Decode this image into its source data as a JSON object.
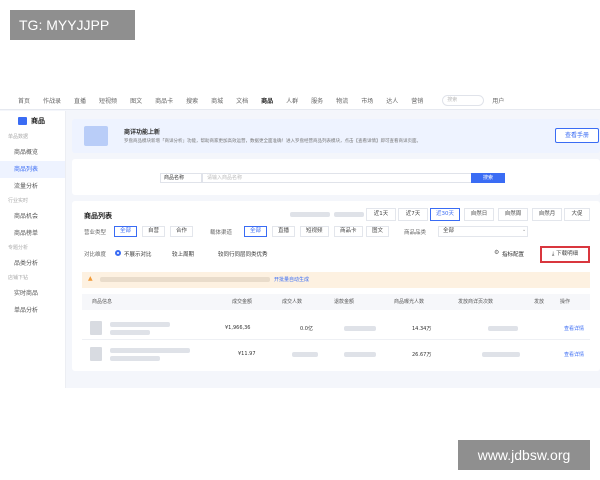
{
  "watermarks": {
    "top_left": "TG: MYYJJPP",
    "bottom_right": "www.jdbsw.org"
  },
  "topnav": {
    "items": [
      "首页",
      "作战录",
      "直播",
      "短视频",
      "图文",
      "商品卡",
      "搜索",
      "商城",
      "文档",
      "商品",
      "人群",
      "服务",
      "物流",
      "市场",
      "达人",
      "营销"
    ],
    "active_index": 9,
    "search_placeholder": "搜索",
    "user": "用户"
  },
  "sidebar": {
    "title": "商品",
    "groups": [
      {
        "label": "单品数据",
        "items": [
          "商品概览",
          "商品列表",
          "流量分析"
        ]
      },
      {
        "label": "行业实时",
        "items": [
          "商品机会",
          "商品榜单"
        ]
      },
      {
        "label": "专题分析",
        "items": [
          "品类分析"
        ]
      },
      {
        "label": "店铺下钻",
        "items": [
          "实时商品",
          "单品分析"
        ]
      }
    ],
    "active_item": "商品列表"
  },
  "banner": {
    "title": "商详功能上新",
    "desc": "罗盘商品模块新增「商详分析」功能，帮助商家更加高效运营，数据更全面准确！进入罗盘经营商品列表模块，点击【查看详情】即可查看商详页面。",
    "button": "查看手册"
  },
  "search": {
    "field_label": "商品名称",
    "placeholder": "请输入商品名称",
    "button": "搜索"
  },
  "list": {
    "title": "商品列表",
    "date_buttons": [
      "近1天",
      "近7天",
      "近30天",
      "自然日",
      "自然周",
      "自然月",
      "大促"
    ],
    "date_active": "近30天",
    "filter_type_label": "营业类型",
    "filter_type_options": [
      "全部",
      "自营",
      "合作"
    ],
    "filter_channel_label": "载体渠道",
    "filter_channel_options": [
      "全部",
      "直播",
      "短视频",
      "商品卡",
      "图文"
    ],
    "category_label": "商品品类",
    "category_value": "全部",
    "compare_label": "对比维度",
    "compare_options": [
      "不展示对比",
      "较上周期",
      "较同行同层同类优秀"
    ],
    "metric_config": "指标配置",
    "download": "下载明细",
    "notice_link": "开批量自动生成",
    "columns": [
      "商品信息",
      "成交金额",
      "成交人数",
      "退款金额",
      "商品曝光人数",
      "发放商详页次数",
      "发放",
      "操作"
    ],
    "rows": [
      {
        "gmv": "¥1,966,36",
        "buyers": "0.0亿",
        "refund": "",
        "exposure": "14.34万",
        "action": "查看详情"
      },
      {
        "gmv": "¥11.97",
        "buyers": "",
        "refund": "",
        "exposure": "26.67万",
        "action": "查看详情"
      }
    ]
  },
  "colors": {
    "accent": "#3a6cf4",
    "highlight": "#d9363e",
    "notice": "#fdf1e1"
  }
}
